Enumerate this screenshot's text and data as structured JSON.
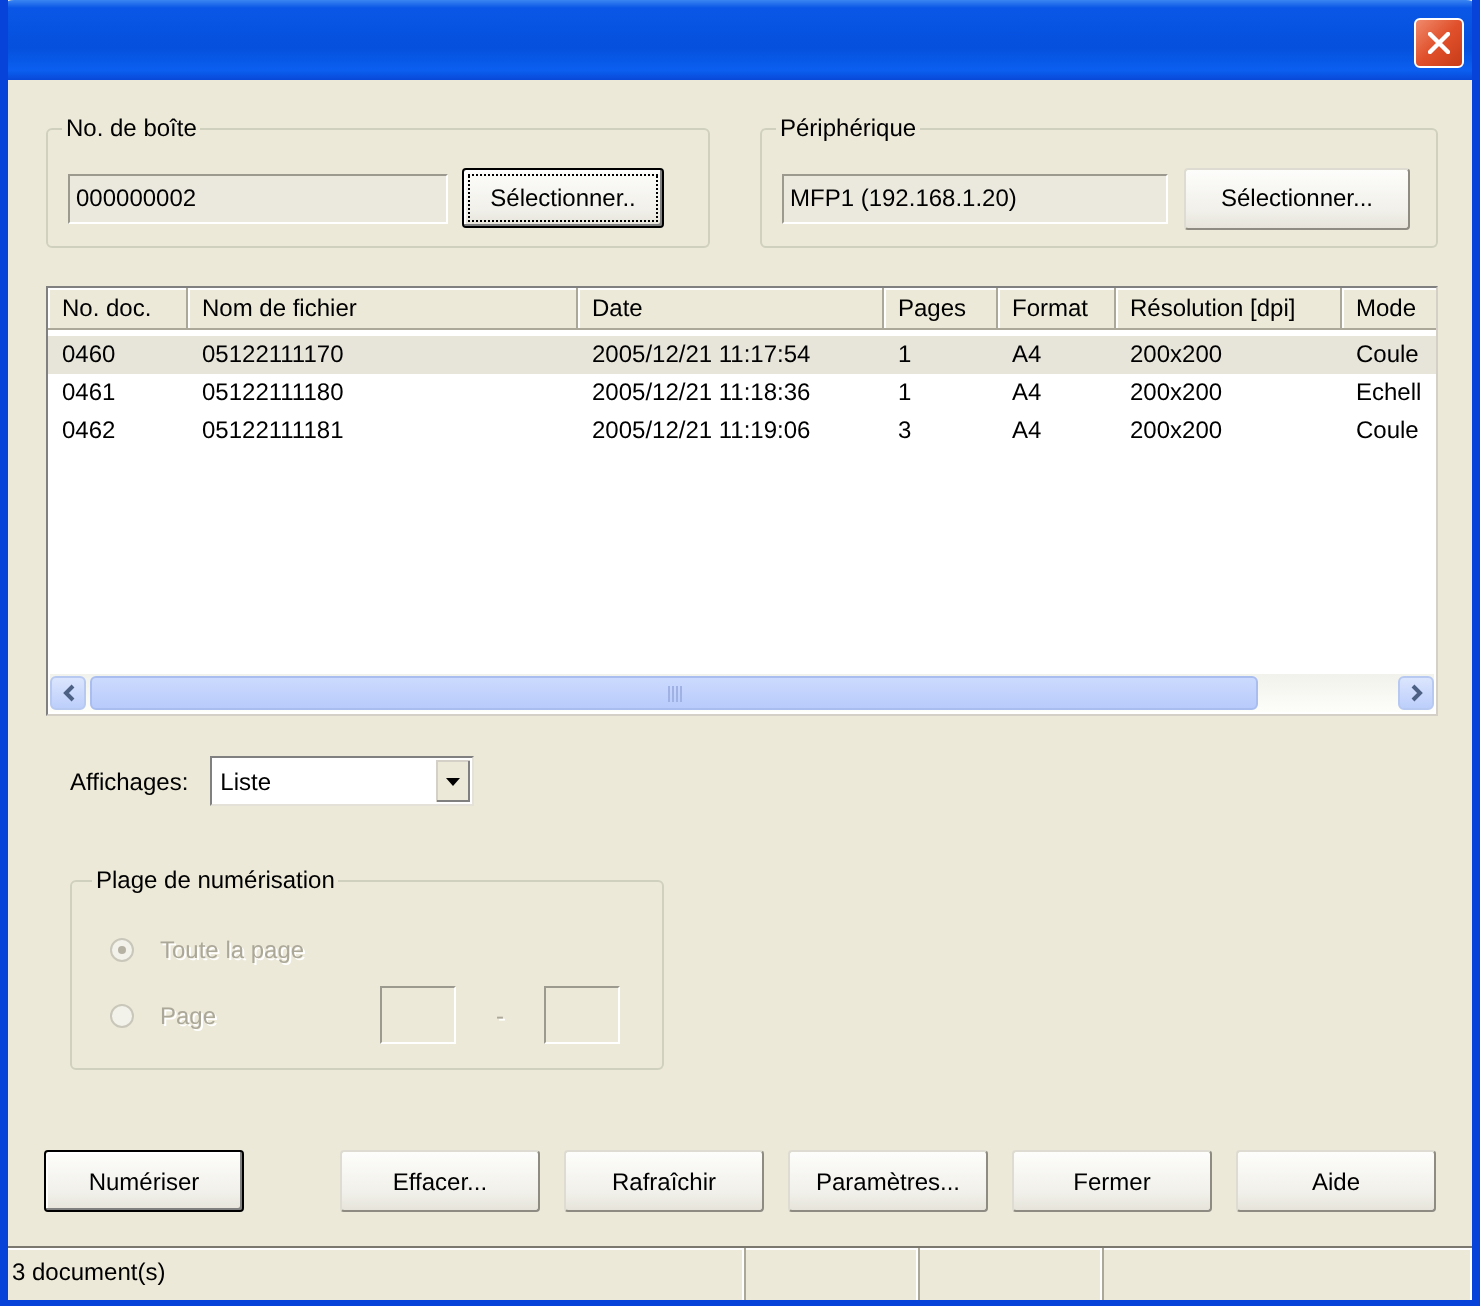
{
  "box_group": {
    "title": "No. de boîte",
    "value": "000000002",
    "button": {
      "label": "Sélectionner..",
      "focused": true
    }
  },
  "device_group": {
    "title": "Périphérique",
    "value": "MFP1 (192.168.1.20)",
    "button": {
      "label": "Sélectionner...",
      "focused": false
    }
  },
  "table": {
    "columns": [
      "No. doc.",
      "Nom de fichier",
      "Date",
      "Pages",
      "Format",
      "Résolution [dpi]",
      "Mode"
    ],
    "rows": [
      {
        "cells": [
          "0460",
          "05122111170",
          "2005/12/21 11:17:54",
          "1",
          "A4",
          "200x200",
          "Coule"
        ],
        "selected": true
      },
      {
        "cells": [
          "0461",
          "05122111180",
          "2005/12/21 11:18:36",
          "1",
          "A4",
          "200x200",
          "Echell"
        ],
        "selected": false
      },
      {
        "cells": [
          "0462",
          "05122111181",
          "2005/12/21 11:19:06",
          "3",
          "A4",
          "200x200",
          "Coule"
        ],
        "selected": false
      }
    ]
  },
  "view": {
    "label": "Affichages:",
    "value": "Liste"
  },
  "scan_range": {
    "title": "Plage de numérisation",
    "disabled": true,
    "options": [
      {
        "kind": "plain",
        "label": "Toute la page",
        "selected": true
      },
      {
        "kind": "range",
        "label": "Page",
        "selected": false,
        "separator": "-"
      }
    ]
  },
  "buttons": [
    {
      "label": "Numériser",
      "default": true
    },
    {
      "label": "Effacer...",
      "default": false
    },
    {
      "label": "Rafraîchir",
      "default": false
    },
    {
      "label": "Paramètres...",
      "default": false
    },
    {
      "label": "Fermer",
      "default": false
    },
    {
      "label": "Aide",
      "default": false
    }
  ],
  "status_bar": {
    "text": "3 document(s)"
  }
}
